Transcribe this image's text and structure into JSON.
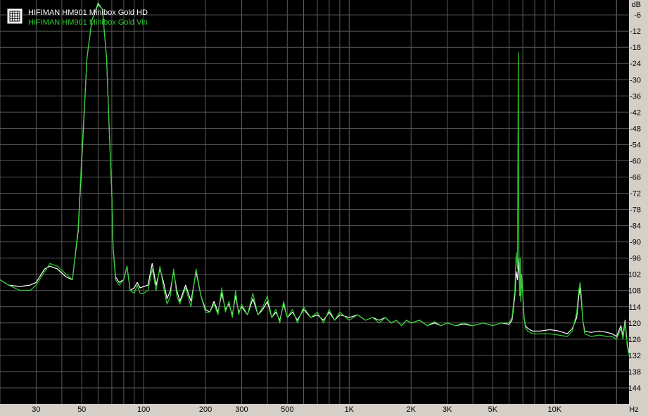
{
  "chart_data": {
    "type": "line",
    "xlabel": "Hz",
    "ylabel": "dB",
    "x_scale": "log",
    "xlim": [
      20,
      23000
    ],
    "ylim": [
      -150,
      -0.5
    ],
    "grid": true,
    "background": "#000000",
    "gridColor": "#5a5a5a",
    "legend_placement": "top-left",
    "legend_icon": "grid-icon",
    "x_ticks": [
      30,
      50,
      100,
      200,
      300,
      500,
      1000,
      2000,
      3000,
      5000,
      10000
    ],
    "x_tick_labels": [
      "30",
      "50",
      "100",
      "200",
      "300",
      "500",
      "1K",
      "2K",
      "3K",
      "5K",
      "10K"
    ],
    "y_ticks": [
      -6,
      -12,
      -18,
      -24,
      -30,
      -36,
      -42,
      -48,
      -54,
      -60,
      -66,
      -72,
      -78,
      -84,
      -90,
      -96,
      -102,
      -108,
      -114,
      -120,
      -126,
      -132,
      -138,
      -144
    ],
    "y_tick_labels": [
      "-6",
      "-12",
      "-18",
      "-24",
      "-30",
      "-36",
      "-42",
      "-48",
      "-54",
      "-60",
      "-66",
      "-72",
      "-78",
      "-84",
      "-90",
      "-96",
      "-102",
      "-108",
      "-114",
      "-120",
      "-126",
      "-132",
      "-138",
      "-144"
    ],
    "series": [
      {
        "name": "HIFIMAN HM901 Minibox Gold HD",
        "color": "#ffffff",
        "points": [
          [
            20,
            -104
          ],
          [
            22,
            -106
          ],
          [
            25,
            -106.5
          ],
          [
            28,
            -106
          ],
          [
            30,
            -105
          ],
          [
            33,
            -100
          ],
          [
            35,
            -99
          ],
          [
            38,
            -100
          ],
          [
            42,
            -103
          ],
          [
            45,
            -104
          ],
          [
            48,
            -86
          ],
          [
            50,
            -60
          ],
          [
            53,
            -22
          ],
          [
            56,
            -8
          ],
          [
            60,
            -2
          ],
          [
            63,
            -4
          ],
          [
            66,
            -22
          ],
          [
            68,
            -48
          ],
          [
            70,
            -72
          ],
          [
            71,
            -92
          ],
          [
            73,
            -103
          ],
          [
            76,
            -105
          ],
          [
            80,
            -104
          ],
          [
            83,
            -99
          ],
          [
            86,
            -108
          ],
          [
            90,
            -107
          ],
          [
            93,
            -105
          ],
          [
            96,
            -107
          ],
          [
            100,
            -106.5
          ],
          [
            105,
            -106
          ],
          [
            110,
            -98
          ],
          [
            115,
            -106
          ],
          [
            120,
            -100
          ],
          [
            125,
            -105
          ],
          [
            130,
            -111
          ],
          [
            135,
            -108
          ],
          [
            140,
            -101
          ],
          [
            145,
            -108
          ],
          [
            150,
            -112
          ],
          [
            160,
            -106
          ],
          [
            170,
            -112
          ],
          [
            180,
            -101
          ],
          [
            190,
            -110
          ],
          [
            200,
            -115
          ],
          [
            210,
            -116
          ],
          [
            220,
            -112
          ],
          [
            230,
            -116
          ],
          [
            240,
            -109
          ],
          [
            250,
            -115
          ],
          [
            260,
            -113
          ],
          [
            270,
            -117
          ],
          [
            280,
            -110
          ],
          [
            290,
            -116
          ],
          [
            300,
            -114
          ],
          [
            320,
            -117
          ],
          [
            340,
            -111
          ],
          [
            360,
            -117
          ],
          [
            380,
            -115
          ],
          [
            400,
            -112
          ],
          [
            420,
            -118
          ],
          [
            440,
            -116
          ],
          [
            460,
            -119
          ],
          [
            480,
            -113
          ],
          [
            500,
            -118
          ],
          [
            530,
            -116
          ],
          [
            560,
            -119
          ],
          [
            600,
            -115
          ],
          [
            650,
            -118
          ],
          [
            700,
            -117
          ],
          [
            750,
            -119
          ],
          [
            800,
            -116
          ],
          [
            850,
            -119
          ],
          [
            900,
            -117
          ],
          [
            1000,
            -118
          ],
          [
            1100,
            -117
          ],
          [
            1200,
            -119
          ],
          [
            1300,
            -118
          ],
          [
            1400,
            -119
          ],
          [
            1500,
            -118
          ],
          [
            1600,
            -120
          ],
          [
            1700,
            -119
          ],
          [
            1800,
            -121
          ],
          [
            1900,
            -119
          ],
          [
            2000,
            -120
          ],
          [
            2200,
            -119
          ],
          [
            2400,
            -121
          ],
          [
            2600,
            -120
          ],
          [
            2800,
            -121
          ],
          [
            3000,
            -120
          ],
          [
            3300,
            -121
          ],
          [
            3600,
            -120.5
          ],
          [
            4000,
            -121
          ],
          [
            4500,
            -120
          ],
          [
            5000,
            -121
          ],
          [
            5500,
            -120
          ],
          [
            6000,
            -120.5
          ],
          [
            6200,
            -119
          ],
          [
            6400,
            -110
          ],
          [
            6500,
            -101
          ],
          [
            6600,
            -104
          ],
          [
            6700,
            -96
          ],
          [
            6760,
            -110
          ],
          [
            6800,
            -98
          ],
          [
            6850,
            -112
          ],
          [
            6900,
            -102
          ],
          [
            7000,
            -110
          ],
          [
            7100,
            -118
          ],
          [
            7200,
            -121
          ],
          [
            7400,
            -122
          ],
          [
            7800,
            -123
          ],
          [
            8500,
            -123
          ],
          [
            9500,
            -122.5
          ],
          [
            10500,
            -123
          ],
          [
            11500,
            -124
          ],
          [
            12200,
            -122
          ],
          [
            12800,
            -118
          ],
          [
            13100,
            -110
          ],
          [
            13300,
            -107
          ],
          [
            13500,
            -112
          ],
          [
            13700,
            -119
          ],
          [
            14000,
            -123
          ],
          [
            15000,
            -123.5
          ],
          [
            16500,
            -123
          ],
          [
            18000,
            -123.5
          ],
          [
            19000,
            -124
          ],
          [
            20000,
            -125
          ],
          [
            21000,
            -121
          ],
          [
            21500,
            -125
          ],
          [
            22000,
            -119
          ],
          [
            22500,
            -127
          ],
          [
            23000,
            -131
          ]
        ]
      },
      {
        "name": "HIFIMAN HM901 Minibox Gold Vin",
        "color": "#2ecc2e",
        "points": [
          [
            20,
            -104
          ],
          [
            22,
            -106
          ],
          [
            25,
            -108
          ],
          [
            28,
            -108
          ],
          [
            30,
            -106
          ],
          [
            33,
            -101
          ],
          [
            35,
            -98
          ],
          [
            38,
            -99
          ],
          [
            42,
            -102
          ],
          [
            45,
            -104
          ],
          [
            48,
            -85
          ],
          [
            50,
            -58
          ],
          [
            53,
            -22
          ],
          [
            56,
            -8
          ],
          [
            60,
            -1.5
          ],
          [
            63,
            -4
          ],
          [
            66,
            -22
          ],
          [
            68,
            -48
          ],
          [
            70,
            -72
          ],
          [
            71,
            -92
          ],
          [
            73,
            -104
          ],
          [
            76,
            -106
          ],
          [
            80,
            -104
          ],
          [
            83,
            -99
          ],
          [
            86,
            -108
          ],
          [
            90,
            -109
          ],
          [
            93,
            -106
          ],
          [
            96,
            -109
          ],
          [
            100,
            -109
          ],
          [
            105,
            -108
          ],
          [
            110,
            -100
          ],
          [
            115,
            -108
          ],
          [
            120,
            -99
          ],
          [
            125,
            -107
          ],
          [
            130,
            -113
          ],
          [
            135,
            -110
          ],
          [
            140,
            -100
          ],
          [
            145,
            -110
          ],
          [
            150,
            -113
          ],
          [
            160,
            -107
          ],
          [
            170,
            -114
          ],
          [
            180,
            -100
          ],
          [
            190,
            -110
          ],
          [
            200,
            -116
          ],
          [
            210,
            -116
          ],
          [
            220,
            -113
          ],
          [
            230,
            -117
          ],
          [
            240,
            -107
          ],
          [
            250,
            -116
          ],
          [
            260,
            -112
          ],
          [
            270,
            -118
          ],
          [
            280,
            -108
          ],
          [
            290,
            -117
          ],
          [
            300,
            -113
          ],
          [
            320,
            -117
          ],
          [
            340,
            -109
          ],
          [
            360,
            -117
          ],
          [
            380,
            -114
          ],
          [
            400,
            -110
          ],
          [
            420,
            -118
          ],
          [
            440,
            -115
          ],
          [
            460,
            -120
          ],
          [
            480,
            -112
          ],
          [
            500,
            -118
          ],
          [
            530,
            -115
          ],
          [
            560,
            -120
          ],
          [
            600,
            -114
          ],
          [
            650,
            -118
          ],
          [
            700,
            -116
          ],
          [
            750,
            -120
          ],
          [
            800,
            -115
          ],
          [
            850,
            -119
          ],
          [
            900,
            -116
          ],
          [
            1000,
            -119
          ],
          [
            1100,
            -117
          ],
          [
            1200,
            -119
          ],
          [
            1300,
            -118
          ],
          [
            1400,
            -120
          ],
          [
            1500,
            -118
          ],
          [
            1600,
            -120
          ],
          [
            1700,
            -119
          ],
          [
            1800,
            -121
          ],
          [
            1900,
            -119
          ],
          [
            2000,
            -120
          ],
          [
            2200,
            -119
          ],
          [
            2400,
            -121
          ],
          [
            2600,
            -119.5
          ],
          [
            2800,
            -121
          ],
          [
            3000,
            -120
          ],
          [
            3300,
            -121
          ],
          [
            3600,
            -120
          ],
          [
            4000,
            -121
          ],
          [
            4500,
            -120
          ],
          [
            5000,
            -121
          ],
          [
            5500,
            -120
          ],
          [
            6000,
            -120
          ],
          [
            6200,
            -118
          ],
          [
            6400,
            -108
          ],
          [
            6500,
            -94
          ],
          [
            6600,
            -100
          ],
          [
            6650,
            -20
          ],
          [
            6700,
            -92
          ],
          [
            6760,
            -110
          ],
          [
            6800,
            -96
          ],
          [
            6850,
            -112
          ],
          [
            6900,
            -102
          ],
          [
            7000,
            -110
          ],
          [
            7100,
            -118
          ],
          [
            7200,
            -122
          ],
          [
            7400,
            -123
          ],
          [
            7800,
            -124
          ],
          [
            8500,
            -124
          ],
          [
            9500,
            -124
          ],
          [
            10500,
            -124.5
          ],
          [
            11500,
            -125
          ],
          [
            12200,
            -123
          ],
          [
            12800,
            -116
          ],
          [
            13100,
            -108
          ],
          [
            13300,
            -105
          ],
          [
            13500,
            -110
          ],
          [
            13700,
            -119
          ],
          [
            14000,
            -124
          ],
          [
            15000,
            -125
          ],
          [
            16500,
            -124.5
          ],
          [
            18000,
            -125
          ],
          [
            19000,
            -125
          ],
          [
            20000,
            -126
          ],
          [
            21000,
            -122
          ],
          [
            21500,
            -126
          ],
          [
            22000,
            -120
          ],
          [
            22500,
            -128
          ],
          [
            23000,
            -132
          ]
        ]
      }
    ]
  }
}
